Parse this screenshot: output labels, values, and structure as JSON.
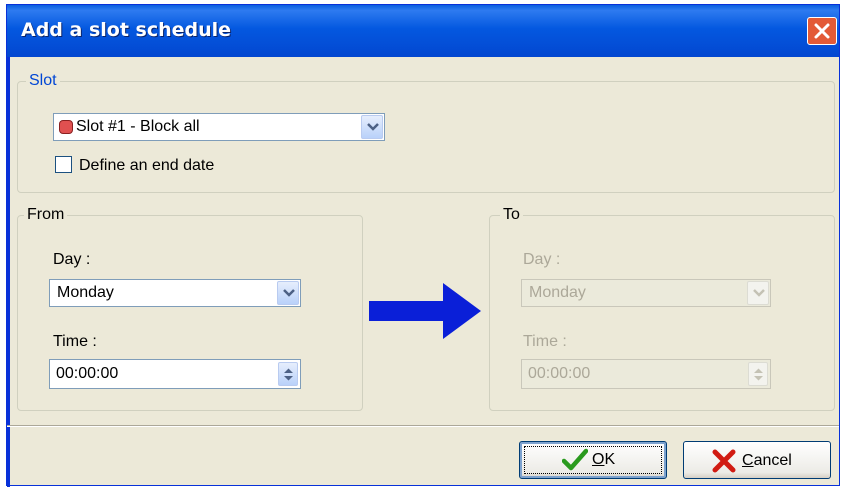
{
  "window": {
    "title": "Add a slot schedule",
    "close_icon": "close-icon"
  },
  "slot_group": {
    "legend": "Slot",
    "slot_select": {
      "value": "Slot #1 - Block all",
      "color_indicator": "#E05050"
    },
    "end_date_checkbox": {
      "label": "Define an end date",
      "checked": false
    }
  },
  "from_group": {
    "legend": "From",
    "day_label": "Day :",
    "day_value": "Monday",
    "time_label": "Time :",
    "time_value": "00:00:00"
  },
  "arrow": {
    "icon": "right-arrow-icon",
    "color": "#0A1FD8"
  },
  "to_group": {
    "legend": "To",
    "day_label": "Day :",
    "day_value": "Monday",
    "time_label": "Time :",
    "time_value": "00:00:00",
    "enabled": false
  },
  "buttons": {
    "ok_mnemonic": "O",
    "ok_rest": "K",
    "ok_icon": "checkmark-icon",
    "cancel_mnemonic": "C",
    "cancel_rest": "ancel",
    "cancel_icon": "x-cross-icon"
  }
}
